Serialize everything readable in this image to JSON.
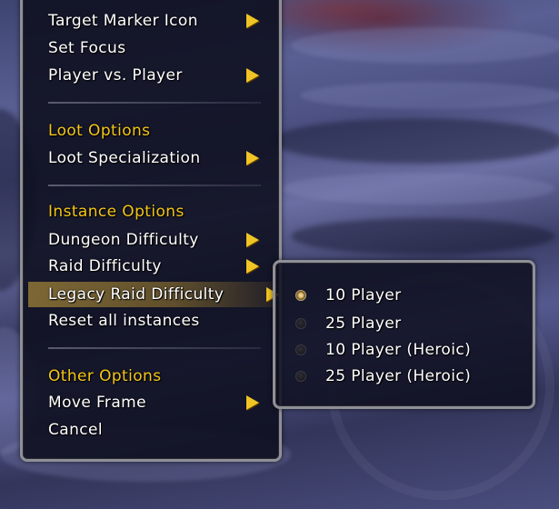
{
  "menu": {
    "items": [
      {
        "label": "Target Marker Icon",
        "type": "submenu"
      },
      {
        "label": "Set Focus",
        "type": "action"
      },
      {
        "label": "Player vs. Player",
        "type": "submenu"
      },
      {
        "label": "Loot Options",
        "type": "header"
      },
      {
        "label": "Loot Specialization",
        "type": "submenu"
      },
      {
        "label": "Instance Options",
        "type": "header"
      },
      {
        "label": "Dungeon Difficulty",
        "type": "submenu"
      },
      {
        "label": "Raid Difficulty",
        "type": "submenu"
      },
      {
        "label": "Legacy Raid Difficulty",
        "type": "submenu",
        "state": "highlighted"
      },
      {
        "label": "Reset all instances",
        "type": "action"
      },
      {
        "label": "Other Options",
        "type": "header"
      },
      {
        "label": "Move Frame",
        "type": "submenu"
      },
      {
        "label": "Cancel",
        "type": "action"
      }
    ]
  },
  "submenu": {
    "parent": "Legacy Raid Difficulty",
    "selected": "10 Player",
    "options": [
      {
        "label": "10 Player",
        "checked": true
      },
      {
        "label": "25 Player",
        "checked": false
      },
      {
        "label": "10 Player (Heroic)",
        "checked": false
      },
      {
        "label": "25 Player (Heroic)",
        "checked": false
      }
    ]
  },
  "colors": {
    "header_text": "#f4c61a",
    "item_text": "#ffffff",
    "submenu_arrow": "#f0c424",
    "highlight": "#d2aa3c",
    "menu_background": "#0e0f20",
    "menu_border": "#8f8f96"
  },
  "icons": {
    "submenu_arrow": "triangle-right-icon",
    "radio_checked": "radio-checked-icon",
    "radio_unchecked": "radio-unchecked-icon"
  }
}
